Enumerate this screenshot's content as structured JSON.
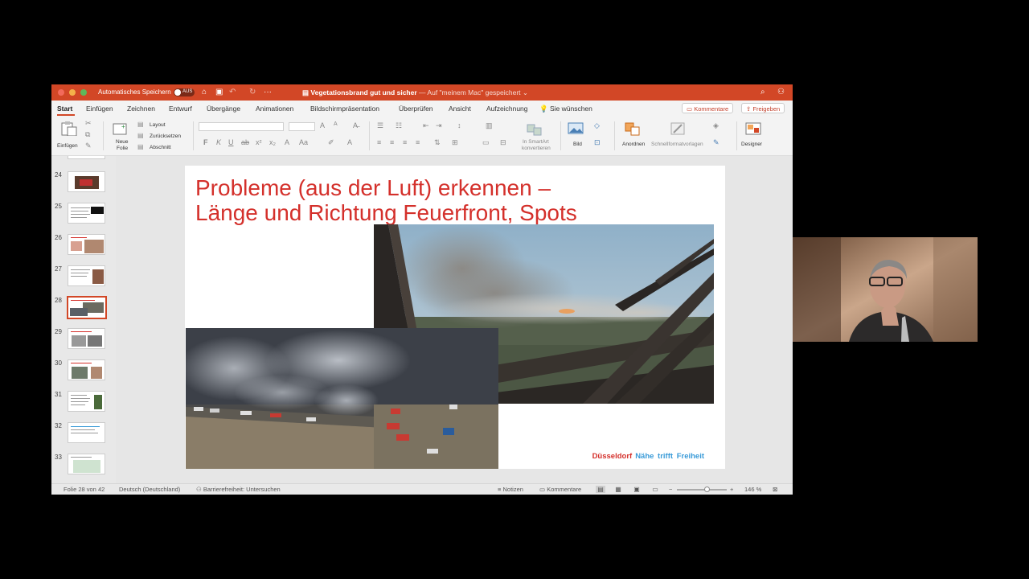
{
  "window": {
    "autosave_label": "Automatisches Speichern",
    "autosave_state": "AUS",
    "doc_title": "Vegetationsbrand gut und sicher",
    "doc_subtitle": "— Auf \"meinem Mac\" gespeichert ⌄"
  },
  "tabs": [
    "Start",
    "Einfügen",
    "Zeichnen",
    "Entwurf",
    "Übergänge",
    "Animationen",
    "Bildschirmpräsentation",
    "Überprüfen",
    "Ansicht",
    "Aufzeichnung"
  ],
  "active_tab": "Start",
  "tell_me": "Sie wünschen",
  "comments_button": "Kommentare",
  "share_button": "Freigeben",
  "ribbon": {
    "paste": "Einfügen",
    "new_slide_1": "Neue",
    "new_slide_2": "Folie",
    "layout": "Layout",
    "reset": "Zurücksetzen",
    "section": "Abschnitt",
    "smartart_1": "In SmartArt",
    "smartart_2": "konvertieren",
    "picture": "Bild",
    "arrange": "Anordnen",
    "quick_styles": "Schnellformatvorlagen",
    "designer": "Designer"
  },
  "thumbnails": [
    {
      "num": "24"
    },
    {
      "num": "25"
    },
    {
      "num": "26"
    },
    {
      "num": "27"
    },
    {
      "num": "28"
    },
    {
      "num": "29"
    },
    {
      "num": "30"
    },
    {
      "num": "31"
    },
    {
      "num": "32"
    },
    {
      "num": "33"
    }
  ],
  "slide": {
    "title": "Probleme (aus der Luft) erkennen –\nLänge und Richtung Feuerfront, Spots",
    "brand_city": "Düsseldorf",
    "brand_tagline": "Nähe trifft Freiheit"
  },
  "status": {
    "slide_count": "Folie 28 von 42",
    "language": "Deutsch (Deutschland)",
    "accessibility": "Barrierefreiheit: Untersuchen",
    "notes": "Notizen",
    "comments": "Kommentare",
    "zoom": "146 %",
    "zoom_level": 0.6
  }
}
